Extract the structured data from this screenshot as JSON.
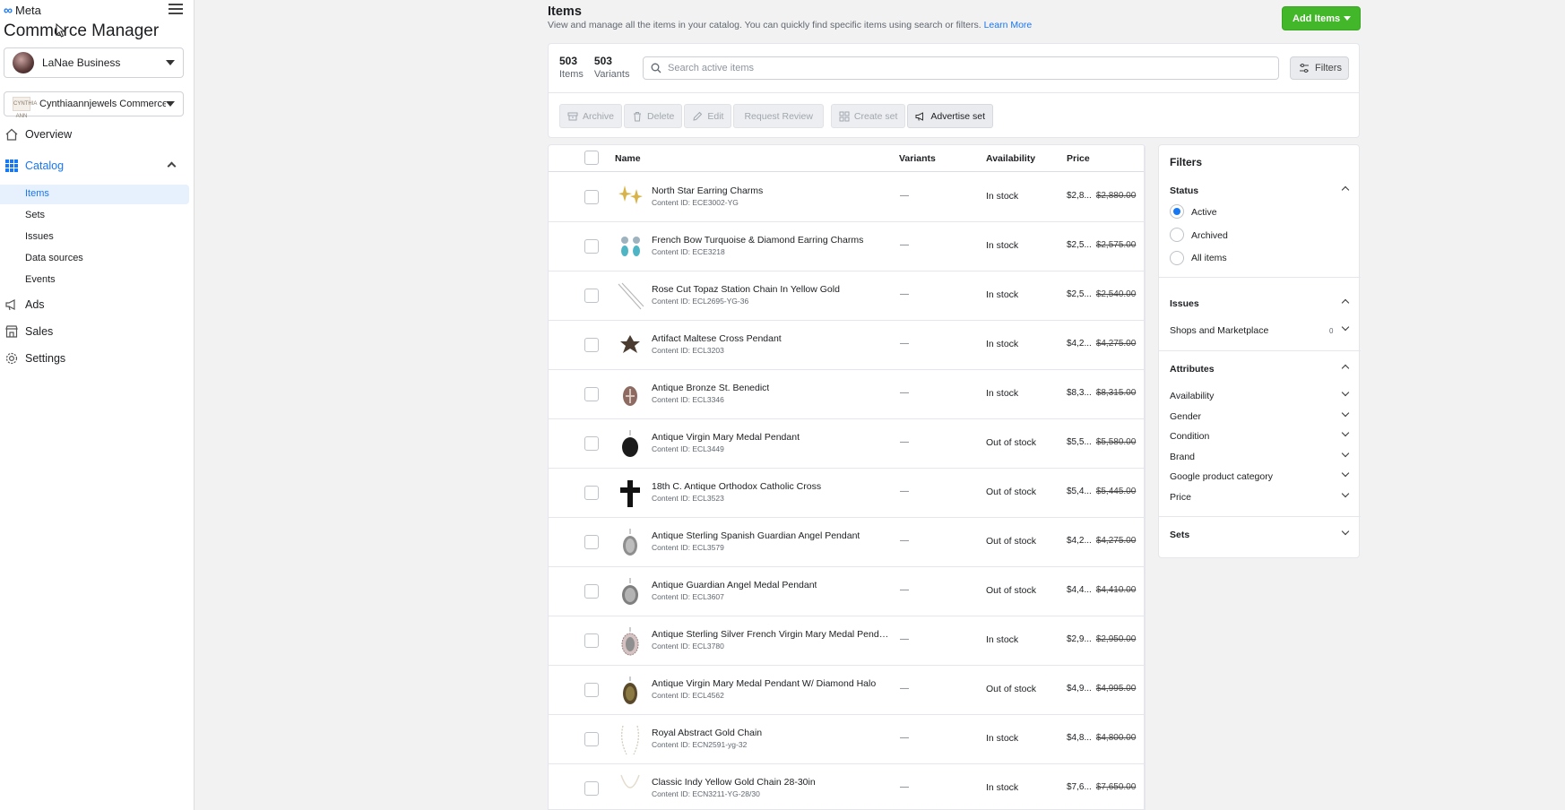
{
  "brand": {
    "name": "Meta",
    "app_title": "Commerce Manager"
  },
  "sidebar": {
    "business_account": "LaNae Business",
    "catalog_account": "Cynthiaannjewels Commerce ...",
    "catalog_logo_text": "CYNTHIA ANN",
    "nav": [
      {
        "label": "Overview"
      },
      {
        "label": "Catalog"
      },
      {
        "label": "Ads"
      },
      {
        "label": "Sales"
      },
      {
        "label": "Settings"
      }
    ],
    "catalog_sub": [
      {
        "label": "Items"
      },
      {
        "label": "Sets"
      },
      {
        "label": "Issues"
      },
      {
        "label": "Data sources"
      },
      {
        "label": "Events"
      }
    ]
  },
  "header": {
    "title": "Items",
    "description": "View and manage all the items in your catalog. You can quickly find specific items using search or filters.",
    "learn_more": "Learn More",
    "add_items_label": "Add Items"
  },
  "summary": {
    "items_count": "503",
    "items_label": "Items",
    "variants_count": "503",
    "variants_label": "Variants",
    "search_placeholder": "Search active items",
    "filters_label": "Filters"
  },
  "toolbar": {
    "archive": "Archive",
    "delete": "Delete",
    "edit": "Edit",
    "request_review": "Request Review",
    "create_set": "Create set",
    "advertise_set": "Advertise set"
  },
  "table": {
    "columns": {
      "name": "Name",
      "variants": "Variants",
      "availability": "Availability",
      "price": "Price"
    },
    "rows": [
      {
        "name": "North Star Earring Charms",
        "content_id": "Content ID: ECE3002-YG",
        "variants": "—",
        "availability": "In stock",
        "price": "$2,8...",
        "original_price": "$2,880.00"
      },
      {
        "name": "French Bow Turquoise & Diamond Earring Charms",
        "content_id": "Content ID: ECE3218",
        "variants": "—",
        "availability": "In stock",
        "price": "$2,5...",
        "original_price": "$2,575.00"
      },
      {
        "name": "Rose Cut Topaz Station Chain In Yellow Gold",
        "content_id": "Content ID: ECL2695-YG-36",
        "variants": "—",
        "availability": "In stock",
        "price": "$2,5...",
        "original_price": "$2,540.00"
      },
      {
        "name": "Artifact Maltese Cross Pendant",
        "content_id": "Content ID: ECL3203",
        "variants": "—",
        "availability": "In stock",
        "price": "$4,2...",
        "original_price": "$4,275.00"
      },
      {
        "name": "Antique Bronze St. Benedict",
        "content_id": "Content ID: ECL3346",
        "variants": "—",
        "availability": "In stock",
        "price": "$8,3...",
        "original_price": "$8,315.00"
      },
      {
        "name": "Antique Virgin Mary Medal Pendant",
        "content_id": "Content ID: ECL3449",
        "variants": "—",
        "availability": "Out of stock",
        "price": "$5,5...",
        "original_price": "$5,580.00"
      },
      {
        "name": "18th C. Antique Orthodox Catholic Cross",
        "content_id": "Content ID: ECL3523",
        "variants": "—",
        "availability": "Out of stock",
        "price": "$5,4...",
        "original_price": "$5,445.00"
      },
      {
        "name": "Antique Sterling Spanish Guardian Angel Pendant",
        "content_id": "Content ID: ECL3579",
        "variants": "—",
        "availability": "Out of stock",
        "price": "$4,2...",
        "original_price": "$4,275.00"
      },
      {
        "name": "Antique Guardian Angel Medal Pendant",
        "content_id": "Content ID: ECL3607",
        "variants": "—",
        "availability": "Out of stock",
        "price": "$4,4...",
        "original_price": "$4,410.00"
      },
      {
        "name": "Antique Sterling Silver French Virgin Mary Medal Penda...",
        "content_id": "Content ID: ECL3780",
        "variants": "—",
        "availability": "In stock",
        "price": "$2,9...",
        "original_price": "$2,950.00"
      },
      {
        "name": "Antique Virgin Mary Medal Pendant W/ Diamond Halo",
        "content_id": "Content ID: ECL4562",
        "variants": "—",
        "availability": "Out of stock",
        "price": "$4,9...",
        "original_price": "$4,995.00"
      },
      {
        "name": "Royal Abstract Gold Chain",
        "content_id": "Content ID: ECN2591-yg-32",
        "variants": "—",
        "availability": "In stock",
        "price": "$4,8...",
        "original_price": "$4,800.00"
      },
      {
        "name": "Classic Indy Yellow Gold Chain 28-30in",
        "content_id": "Content ID: ECN3211-YG-28/30",
        "variants": "—",
        "availability": "In stock",
        "price": "$7,6...",
        "original_price": "$7,650.00"
      }
    ]
  },
  "filters": {
    "title": "Filters",
    "status_label": "Status",
    "status_options": [
      "Active",
      "Archived",
      "All items"
    ],
    "status_selected": "Active",
    "issues_label": "Issues",
    "issues_items": [
      {
        "label": "Shops and Marketplace",
        "count": "0"
      }
    ],
    "attributes_label": "Attributes",
    "attributes": [
      "Availability",
      "Gender",
      "Condition",
      "Brand",
      "Google product category",
      "Price"
    ],
    "sets_label": "Sets"
  },
  "colors": {
    "accent": "#1877f2",
    "add_button": "#42b72a"
  }
}
